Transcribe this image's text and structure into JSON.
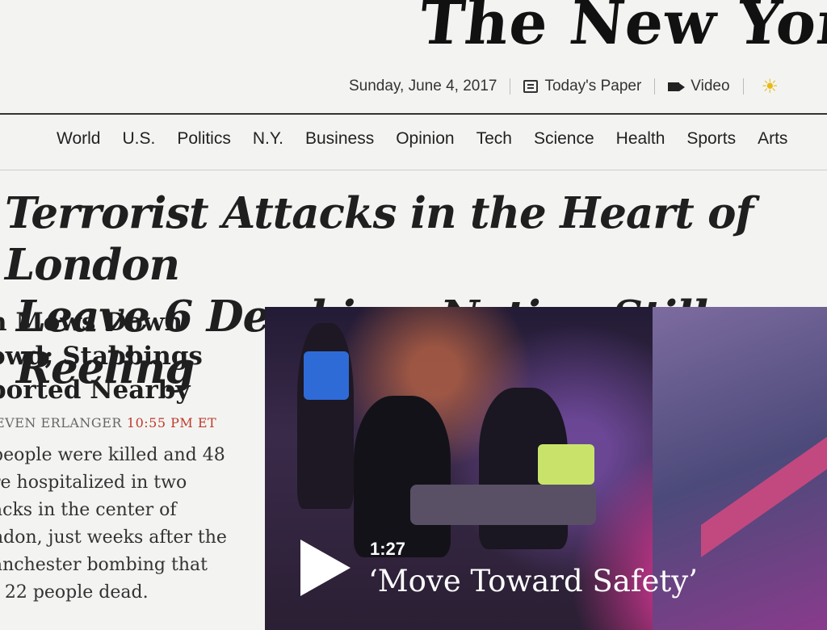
{
  "masthead": {
    "title": "The New York"
  },
  "datebar": {
    "date": "Sunday, June 4, 2017",
    "todays_paper": "Today's Paper",
    "video": "Video"
  },
  "nav": {
    "items": [
      "World",
      "U.S.",
      "Politics",
      "N.Y.",
      "Business",
      "Opinion",
      "Tech",
      "Science",
      "Health",
      "Sports",
      "Arts"
    ]
  },
  "headline": {
    "line1": "Terrorist Attacks in the Heart of London",
    "line2": "Leave 6 Dead in a Nation Still Reeling"
  },
  "story": {
    "sub_lines": [
      "n Mows Down",
      "owd; Stabbings",
      "ported Nearby"
    ],
    "byline": "EVEN ERLANGER",
    "time": "10:55 PM ET",
    "summary_lines": [
      "people were killed and 48",
      "re hospitalized in two",
      "acks in the center of",
      "ndon, just weeks after the",
      "anchester bombing that",
      "t 22 people dead."
    ]
  },
  "video": {
    "duration": "1:27",
    "title": "‘Move Toward Safety’"
  },
  "colors": {
    "timestamp": "#c0392b",
    "sun": "#e8b917"
  }
}
